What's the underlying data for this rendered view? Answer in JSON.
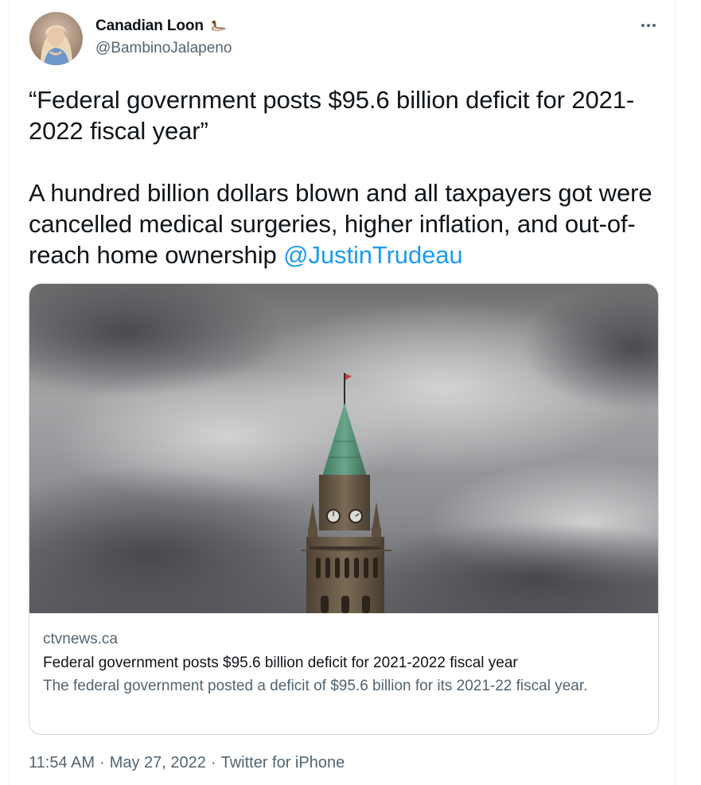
{
  "author": {
    "display_name": "Canadian Loon",
    "emoji_icon": "loon-duck-icon",
    "handle": "@BambinoJalapeno"
  },
  "tweet": {
    "paragraph_1": "“Federal government posts $95.6 billion deficit for 2021-2022 fiscal year”",
    "paragraph_2_text": "A hundred billion dollars blown and all taxpayers got were cancelled medical surgeries, higher inflation, and out-of-reach home ownership ",
    "mention": "@JustinTrudeau"
  },
  "card": {
    "image_subject": "Peace Tower under stormy sky",
    "domain": "ctvnews.ca",
    "title": "Federal government posts $95.6 billion deficit for 2021-2022 fiscal year",
    "description": "The federal government posted a deficit of $95.6 billion for its 2021-22 fiscal year."
  },
  "meta": {
    "time": "11:54 AM",
    "separator": "·",
    "date": "May 27, 2022",
    "source": "Twitter for iPhone"
  },
  "colors": {
    "text": "#0f1419",
    "secondary": "#536471",
    "link": "#1d9bf0",
    "border": "#cfd9de"
  }
}
